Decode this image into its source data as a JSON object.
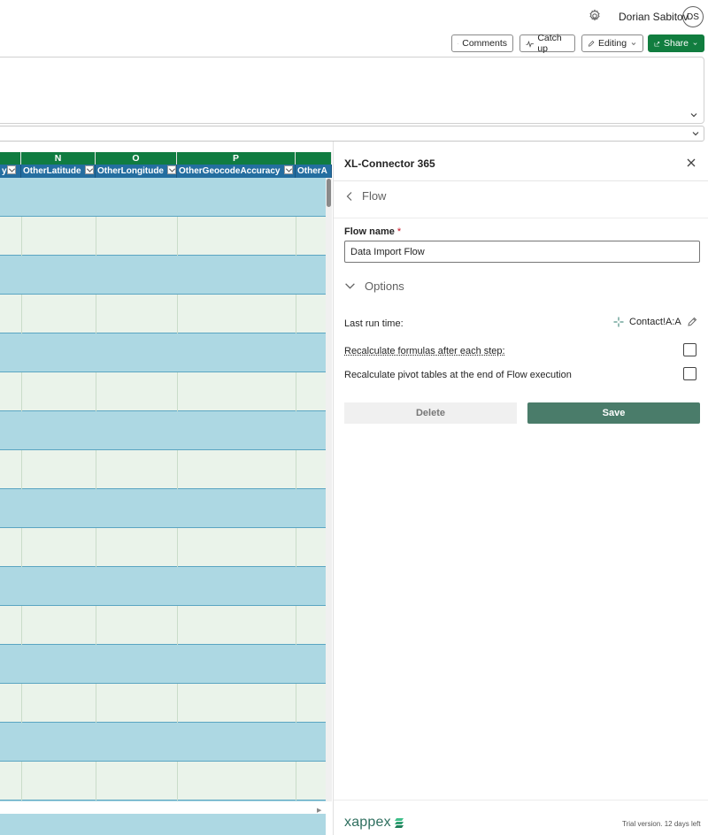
{
  "header": {
    "user_name": "Dorian Sabitov",
    "avatar_initials": "DS",
    "settings_icon": "gear-icon"
  },
  "toolbar": {
    "comments_label": "Comments",
    "catchup_label": "Catch up",
    "editing_label": "Editing",
    "share_label": "Share",
    "share_color": "#117d3f"
  },
  "grid": {
    "column_letters": [
      "",
      "N",
      "O",
      "P",
      ""
    ],
    "column_headers": [
      "y",
      "OtherLatitude",
      "OtherLongitude",
      "OtherGeocodeAccuracy",
      "OtherA"
    ],
    "header_color": "#246ea0",
    "letter_bar_color": "#107c41",
    "row_colors": [
      "#add8e3",
      "#eaf3ea"
    ]
  },
  "pane": {
    "title": "XL-Connector 365",
    "back_label": "Flow",
    "flow_name_label": "Flow name",
    "required_mark": "*",
    "flow_name_value": "Data Import Flow",
    "options_label": "Options",
    "last_run_label": "Last run time:",
    "last_run_target": "Contact!A:A",
    "recalc_label": "Recalculate formulas after each step:",
    "recalc_checked": false,
    "recalc_pivot_label": "Recalculate pivot tables at the end of Flow execution",
    "recalc_pivot_checked": false,
    "delete_label": "Delete",
    "save_label": "Save",
    "save_color": "#4a7c6a",
    "brand_name": "xappex",
    "trial_text": "Trial version. 12 days left"
  }
}
